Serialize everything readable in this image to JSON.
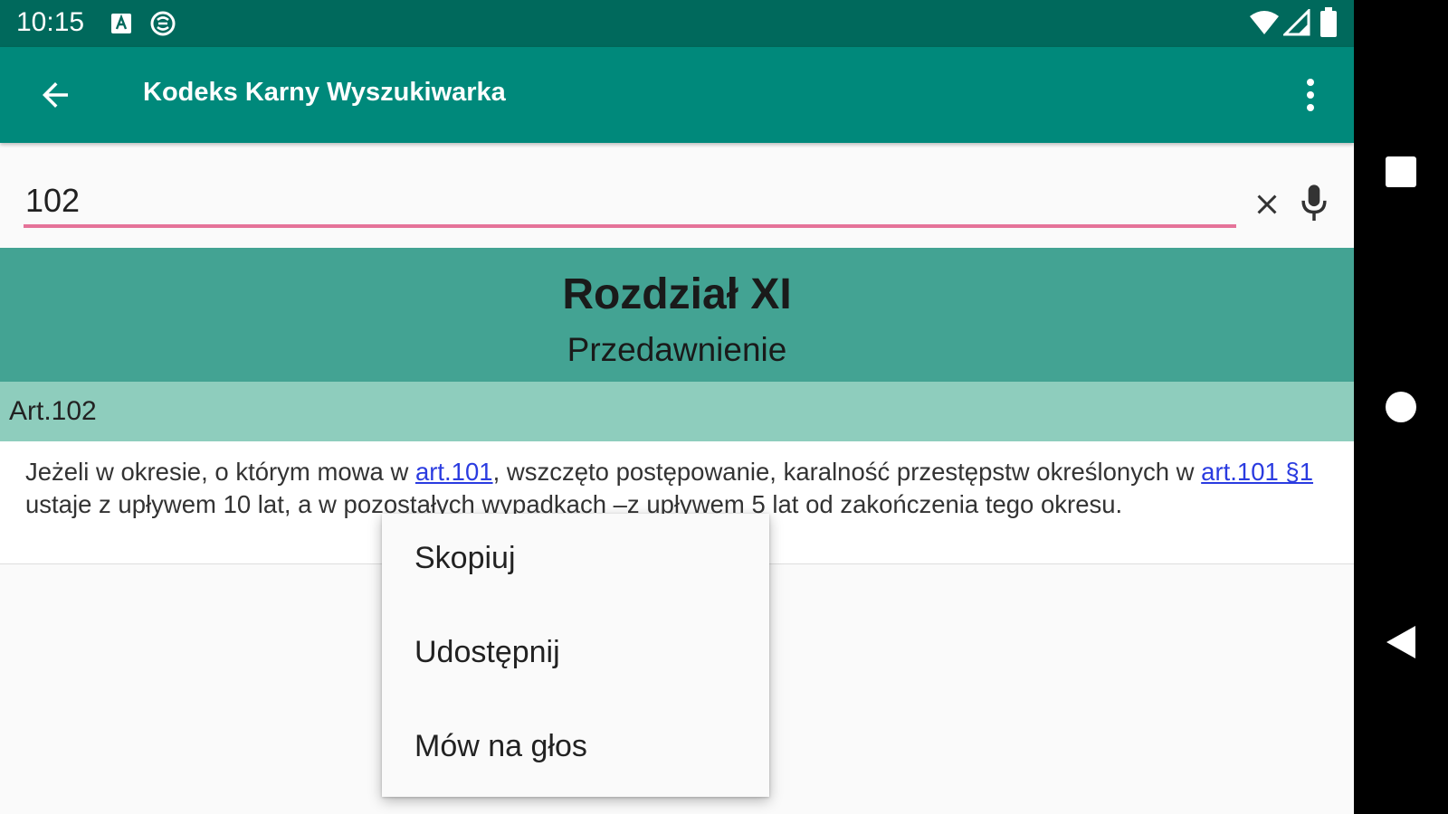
{
  "status_bar": {
    "time": "10:15",
    "icons": [
      "notification-a-icon",
      "sync-icon",
      "wifi-icon",
      "signal-icon",
      "battery-icon"
    ]
  },
  "app_bar": {
    "title": "Kodeks Karny Wyszukiwarka",
    "back_icon": "arrow-left-icon",
    "overflow_icon": "more-vert-icon"
  },
  "search": {
    "value": "102",
    "clear_icon": "close-icon",
    "mic_icon": "mic-icon",
    "underline_color": "#e57399"
  },
  "chapter": {
    "title": "Rozdział XI",
    "subtitle": "Przedawnienie"
  },
  "article": {
    "label": "Art.102",
    "text_part1": "Jeżeli w okresie, o którym mowa w ",
    "link1": "art.101",
    "text_part2": ", wszczęto postępowanie, karalność przestępstw określonych w ",
    "link2": "art.101 §1",
    "text_part3": " ustaje z upływem 10 lat, a w pozostałych wypadkach –z upływem 5 lat od zakończenia tego okresu."
  },
  "context_menu": {
    "items": [
      {
        "label": "Skopiuj"
      },
      {
        "label": "Udostępnij"
      },
      {
        "label": "Mów na głos"
      }
    ]
  },
  "nav_bar": {
    "icons": [
      "recents-square-icon",
      "home-circle-icon",
      "back-triangle-icon"
    ]
  },
  "colors": {
    "status_bar": "#00695c",
    "app_bar": "#00897b",
    "chapter_header": "#43a393",
    "article_header": "#8ecdbd",
    "link": "#2a3be0"
  }
}
